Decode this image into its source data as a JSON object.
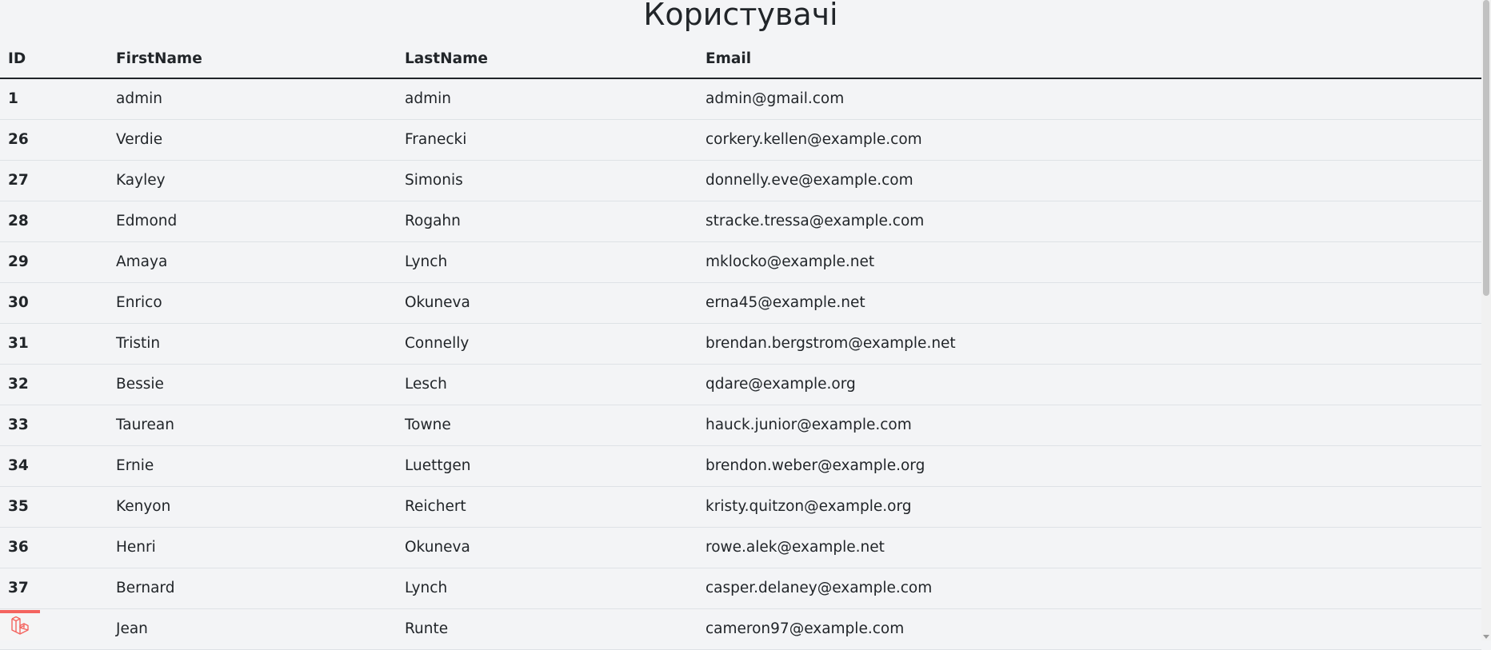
{
  "page": {
    "title": "Користувачі"
  },
  "table": {
    "headers": [
      "ID",
      "FirstName",
      "LastName",
      "Email"
    ],
    "rows": [
      {
        "id": "1",
        "first_name": "admin",
        "last_name": "admin",
        "email": "admin@gmail.com"
      },
      {
        "id": "26",
        "first_name": "Verdie",
        "last_name": "Franecki",
        "email": "corkery.kellen@example.com"
      },
      {
        "id": "27",
        "first_name": "Kayley",
        "last_name": "Simonis",
        "email": "donnelly.eve@example.com"
      },
      {
        "id": "28",
        "first_name": "Edmond",
        "last_name": "Rogahn",
        "email": "stracke.tressa@example.com"
      },
      {
        "id": "29",
        "first_name": "Amaya",
        "last_name": "Lynch",
        "email": "mklocko@example.net"
      },
      {
        "id": "30",
        "first_name": "Enrico",
        "last_name": "Okuneva",
        "email": "erna45@example.net"
      },
      {
        "id": "31",
        "first_name": "Tristin",
        "last_name": "Connelly",
        "email": "brendan.bergstrom@example.net"
      },
      {
        "id": "32",
        "first_name": "Bessie",
        "last_name": "Lesch",
        "email": "qdare@example.org"
      },
      {
        "id": "33",
        "first_name": "Taurean",
        "last_name": "Towne",
        "email": "hauck.junior@example.com"
      },
      {
        "id": "34",
        "first_name": "Ernie",
        "last_name": "Luettgen",
        "email": "brendon.weber@example.org"
      },
      {
        "id": "35",
        "first_name": "Kenyon",
        "last_name": "Reichert",
        "email": "kristy.quitzon@example.org"
      },
      {
        "id": "36",
        "first_name": "Henri",
        "last_name": "Okuneva",
        "email": "rowe.alek@example.net"
      },
      {
        "id": "37",
        "first_name": "Bernard",
        "last_name": "Lynch",
        "email": "casper.delaney@example.com"
      },
      {
        "id": "",
        "first_name": "Jean",
        "last_name": "Runte",
        "email": "cameron97@example.com"
      }
    ]
  },
  "debugbar": {
    "icon": "laravel-logo-icon",
    "accent_color": "#f4645f"
  },
  "colors": {
    "background": "#f3f4f6",
    "text": "#212529",
    "row_border": "#dee2e6"
  }
}
